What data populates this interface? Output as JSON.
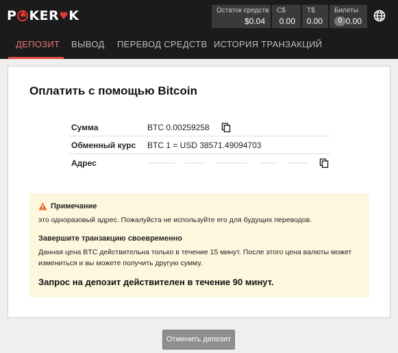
{
  "header": {
    "logo": {
      "p": "P",
      "mid": "KER",
      "k": "K"
    },
    "balances": {
      "funds": {
        "label": "Остаток средств",
        "value": "$0.04"
      },
      "cad": {
        "label": "C$",
        "value": "0.00"
      },
      "tether": {
        "label": "T$",
        "value": "0.00"
      },
      "tickets": {
        "label": "Билеты",
        "count": "0",
        "value": "0.00"
      }
    },
    "language_icon": "globe-icon"
  },
  "tabs": [
    {
      "label": "ДЕПОЗИТ",
      "active": true
    },
    {
      "label": "ВЫВОД",
      "active": false
    },
    {
      "label": "ПЕРЕВОД СРЕДСТВ",
      "active": false
    },
    {
      "label": "ИСТОРИЯ ТРАНЗАКЦИЙ",
      "active": false
    }
  ],
  "payment": {
    "title": "Оплатить с помощью Bitcoin",
    "rows": [
      {
        "key": "Сумма",
        "value": "BTC 0.00259258",
        "copy_icon": "copy-icon"
      },
      {
        "key": "Обменный курс",
        "value": "BTC 1 = USD 38571.49094703"
      },
      {
        "key": "Адрес",
        "value": "",
        "copy_icon": "copy-icon"
      }
    ]
  },
  "notice": {
    "warning_icon": "warning-icon",
    "heading": "Примечание",
    "text": "это одноразовый адрес. Пожалуйста не используйте его для будущих переводов.",
    "heading2": "Завершите транзакцию своевременно",
    "text2": "Данная цена BTC действительна только в течение 15 минут. После этого цена валюты может измениться и вы можете получить другую сумму.",
    "validity": "Запрос на депозит действителен в течение 90 минут."
  },
  "actions": {
    "cancel_label": "Отменить депозит"
  },
  "colors": {
    "header_bg": "#1b1b1b",
    "accent": "#e04a3b",
    "notice_bg": "#fdf7de",
    "button": "#8e8e8e"
  }
}
